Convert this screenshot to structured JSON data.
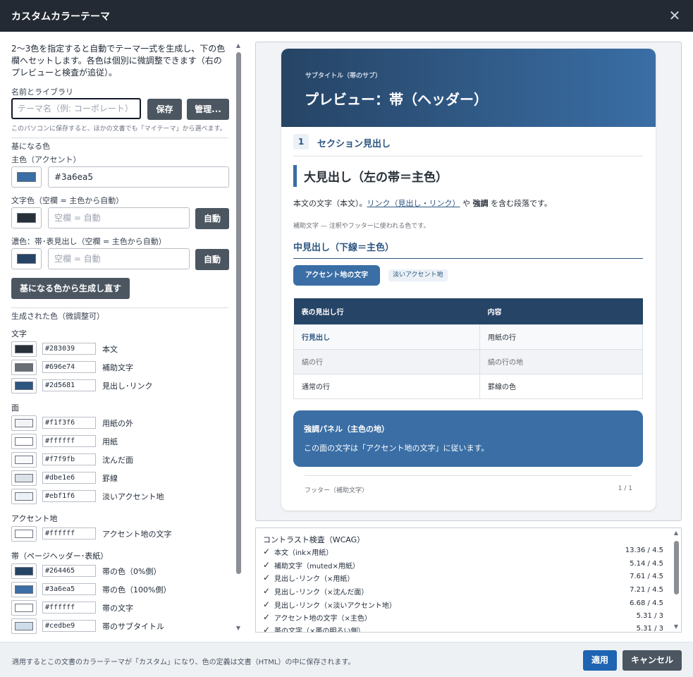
{
  "window": {
    "title": "カスタムカラーテーマ",
    "close_icon": "close-icon"
  },
  "left": {
    "description": "2〜3色を指定すると自動でテーマ一式を生成し、下の色欄へセットします。各色は個別に微調整できます（右のプレビューと検査が追従）。",
    "name_section": {
      "label": "名前とライブラリ",
      "input_placeholder": "テーマ名（例: コーポレート）",
      "input_value": "",
      "save_label": "保存",
      "manage_label": "管理...",
      "hint": "このパソコンに保存すると、ほかの文書でも「マイテーマ」から選べます。"
    },
    "base_section": {
      "label": "基になる色",
      "primary_label": "主色（アクセント）",
      "primary_value": "#3a6ea5",
      "primary_swatch": "#3a6ea5",
      "text_label": "文字色（空欄 = 主色から自動）",
      "text_placeholder": "空欄 = 自動",
      "text_swatch": "#283039",
      "text_auto": "自動",
      "dark_label": "濃色：帯･表見出し（空欄 = 主色から自動）",
      "dark_placeholder": "空欄 = 自動",
      "dark_swatch": "#264465",
      "dark_auto": "自動",
      "regen_label": "基になる色から生成し直す"
    },
    "generated_section": {
      "label": "生成された色（微調整可）",
      "groups": [
        {
          "title": "文字",
          "items": [
            {
              "hex": "#283039",
              "label": "本文"
            },
            {
              "hex": "#696e74",
              "label": "補助文字"
            },
            {
              "hex": "#2d5681",
              "label": "見出し･リンク"
            }
          ]
        },
        {
          "title": "面",
          "items": [
            {
              "hex": "#f1f3f6",
              "label": "用紙の外"
            },
            {
              "hex": "#ffffff",
              "label": "用紙"
            },
            {
              "hex": "#f7f9fb",
              "label": "沈んだ面"
            },
            {
              "hex": "#dbe1e6",
              "label": "罫線"
            },
            {
              "hex": "#ebf1f6",
              "label": "淡いアクセント地"
            }
          ]
        },
        {
          "title": "アクセント地",
          "items": [
            {
              "hex": "#ffffff",
              "label": "アクセント地の文字"
            }
          ]
        },
        {
          "title": "帯（ページヘッダー･表紙）",
          "items": [
            {
              "hex": "#264465",
              "label": "帯の色（0%側）"
            },
            {
              "hex": "#3a6ea5",
              "label": "帯の色（100%側）"
            },
            {
              "hex": "#ffffff",
              "label": "帯の文字"
            },
            {
              "hex": "#cedbe9",
              "label": "帯のサブタイトル"
            }
          ]
        }
      ]
    }
  },
  "preview": {
    "band_subtitle": "サブタイトル（帯のサブ）",
    "band_title": "プレビュー：帯（ヘッダー）",
    "section_number": "1",
    "section_title": "セクション見出し",
    "big_heading": "大見出し（左の帯＝主色）",
    "body_prefix": "本文の文字（本文）。",
    "body_link": "リンク（見出し・リンク）",
    "body_mid": " や ",
    "body_bold": "強調",
    "body_suffix": " を含む段落です。",
    "muted": "補助文字 — 注釈やフッターに使われる色です。",
    "mid_heading": "中見出し（下線＝主色）",
    "chip_accent": "アクセント地の文字",
    "chip_soft": "淡いアクセント地",
    "table": {
      "headers": [
        "表の見出し行",
        "内容"
      ],
      "rows": [
        [
          "行見出し",
          "用紙の行"
        ],
        [
          "縞の行",
          "縞の行の地"
        ],
        [
          "通常の行",
          "罫線の色"
        ]
      ]
    },
    "panel_title": "強調パネル（主色の地）",
    "panel_body": "この面の文字は「アクセント地の文字」に従います。",
    "footer_left": "フッター（補助文字）",
    "footer_right": "1 / 1"
  },
  "contrast": {
    "title": "コントラスト検査（WCAG）",
    "rows": [
      {
        "check": "✓",
        "name": "本文（ink×用紙）",
        "value": "13.36 / 4.5"
      },
      {
        "check": "✓",
        "name": "補助文字（muted×用紙）",
        "value": "5.14 / 4.5"
      },
      {
        "check": "✓",
        "name": "見出し･リンク（×用紙）",
        "value": "7.61 / 4.5"
      },
      {
        "check": "✓",
        "name": "見出し･リンク（×沈んだ面）",
        "value": "7.21 / 4.5"
      },
      {
        "check": "✓",
        "name": "見出し･リンク（×淡いアクセント地）",
        "value": "6.68 / 4.5"
      },
      {
        "check": "✓",
        "name": "アクセント地の文字（×主色）",
        "value": "5.31 / 3"
      },
      {
        "check": "✓",
        "name": "帯の文字（×帯の明るい側）",
        "value": "5.31 / 3"
      }
    ]
  },
  "footer": {
    "note": "適用するとこの文書のカラーテーマが「カスタム」になり、色の定義は文書（HTML）の中に保存されます。",
    "apply_label": "適用",
    "cancel_label": "キャンセル"
  }
}
